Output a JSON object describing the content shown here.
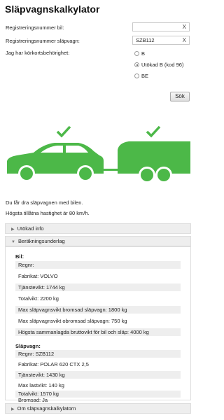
{
  "title": "Släpvagnskalkylator",
  "form": {
    "reg_car_label": "Registreringsnummer bil:",
    "reg_car_value": "",
    "reg_trailer_label": "Registreringsnummer släpvagn:",
    "reg_trailer_value": "SZB112",
    "clear_glyph": "X",
    "license_label": "Jag har körkortsbehörighet:",
    "options": [
      {
        "label": "B",
        "selected": false
      },
      {
        "label": "Utökad B (kod 96)",
        "selected": true
      },
      {
        "label": "BE",
        "selected": false
      }
    ],
    "search_button": "Sök"
  },
  "illustration": {
    "color": "#4cb848",
    "icons": [
      "checkmark-icon",
      "car-icon",
      "trailer-icon"
    ]
  },
  "result": {
    "line1": "Du får dra släpvagnen med bilen.",
    "line2": "Högsta tillåtna hastighet är 80 km/h."
  },
  "accordion": {
    "utokad_info": "Utökad info",
    "berakning": "Beräkningsunderlag",
    "om": "Om släpvagnskalkylatorn"
  },
  "car": {
    "heading": "Bil:",
    "rows": [
      "Regnr:",
      "Fabrikat: VOLVO",
      "Tjänstevikt: 1744 kg",
      "Totalvikt: 2200 kg",
      "Max släpvagnsvikt bromsad släpvagn: 1800 kg",
      "Max släpvagnsvikt obromsad släpvagn: 750 kg",
      "Högsta sammanlagda bruttovikt för bil och släp: 4000 kg"
    ]
  },
  "trailer": {
    "heading": "Släpvagn:",
    "rows": [
      "Regnr: SZB112",
      "Fabrikat: POLAR 620 CTX 2,5",
      "Tjänstevikt: 1430 kg",
      "Max lastvikt: 140 kg",
      "Totalvikt: 1570 kg",
      "Bromsad: Ja"
    ]
  }
}
